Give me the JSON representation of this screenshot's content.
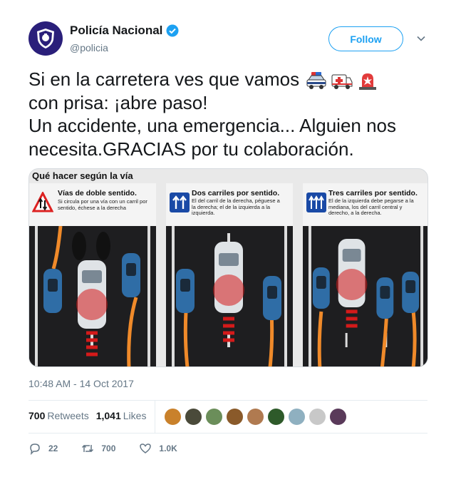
{
  "author": {
    "display_name": "Policía Nacional",
    "handle": "@policia",
    "verified": true,
    "avatar_icon": "police-shield-icon",
    "avatar_color": "#2a1f7a"
  },
  "follow_label": "Follow",
  "tweet": {
    "lines": [
      "Si en la carretera ves que vamos",
      "con prisa: ¡abre paso!",
      "Un accidente, una emergencia... Alguien nos",
      "necesita.GRACIAS por tu colaboración."
    ],
    "emojis": [
      "police-car-icon",
      "ambulance-icon",
      "siren-icon"
    ]
  },
  "media": {
    "title": "Qué hacer según la vía",
    "panels": [
      {
        "title": "Vías de doble sentido.",
        "desc": "Si circula por una vía con un carril por sentido, échese a la derecha",
        "sign_icon": "warning-triangle-icon"
      },
      {
        "title": "Dos carriles por sentido.",
        "desc": "El del carril de la derecha, péguese a la derecha; el de la izquierda a la izquierda.",
        "sign_icon": "two-lanes-sign-icon"
      },
      {
        "title": "Tres carriles por sentido.",
        "desc": "El de la izquierda debe pegarse a la mediana, los del carril central y derecho, a la derecha.",
        "sign_icon": "three-lanes-sign-icon"
      }
    ]
  },
  "timestamp": "10:48 AM - 14 Oct 2017",
  "stats": {
    "retweets_count": "700",
    "retweets_label": "Retweets",
    "likes_count": "1,041",
    "likes_label": "Likes"
  },
  "likers": [
    "#c9812b",
    "#4a4a3a",
    "#6b8e5a",
    "#8a5a2a",
    "#b07a50",
    "#2e5a2a",
    "#8fb0c0",
    "#c8c8c8",
    "#5a3a5a"
  ],
  "actions": {
    "replies": "22",
    "retweets": "700",
    "likes": "1.0K"
  },
  "colors": {
    "accent": "#1da1f2",
    "muted": "#657786",
    "text": "#14171a"
  }
}
